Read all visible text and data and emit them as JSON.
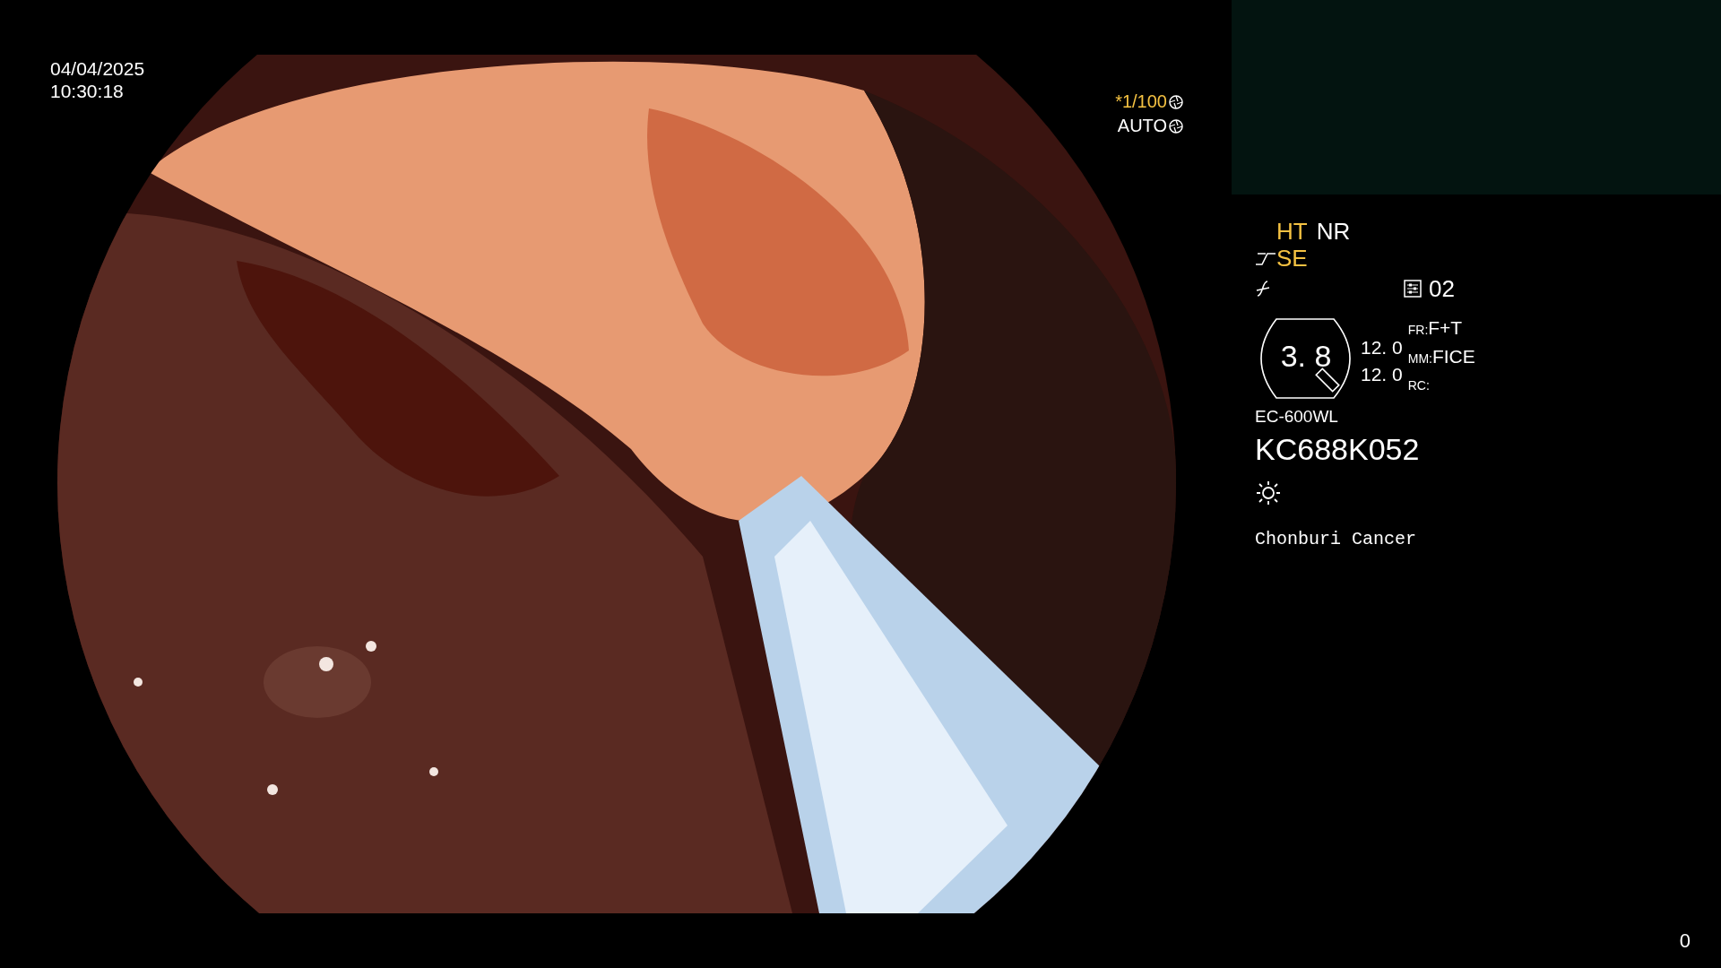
{
  "timestamp": {
    "date": "04/04/2025",
    "time": "10:30:18"
  },
  "exposure": {
    "shutter_mark": "*",
    "shutter": "1/100",
    "iris": "AUTO"
  },
  "modes": [
    {
      "label": "HT",
      "active": true
    },
    {
      "label": "NR",
      "active": false
    }
  ],
  "enhancement": {
    "label": "SE",
    "active": true
  },
  "preset": "02",
  "zoom": {
    "value": "3. 8",
    "readings": [
      "12. 0",
      "12. 0"
    ]
  },
  "settings": [
    {
      "key": "FR:",
      "value": "F+T"
    },
    {
      "key": "MM:",
      "value": "FICE"
    },
    {
      "key": "RC:"
    }
  ],
  "scope_model": "EC-600WL",
  "scope_serial": "KC688K052",
  "institution": "Chonburi Cancer",
  "counter": "0"
}
